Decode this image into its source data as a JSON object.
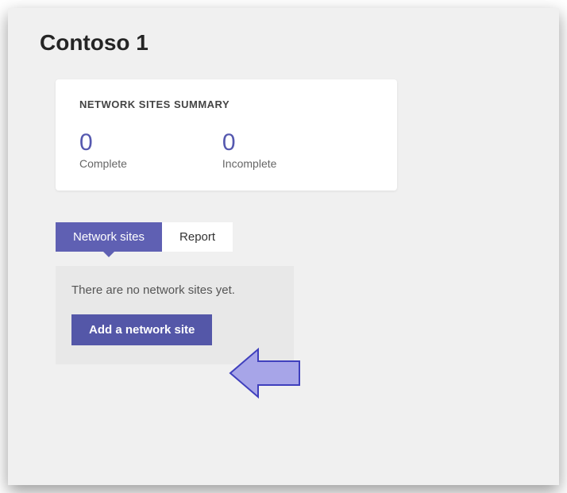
{
  "page_title": "Contoso 1",
  "summary": {
    "header": "NETWORK SITES SUMMARY",
    "stats": [
      {
        "value": "0",
        "label": "Complete"
      },
      {
        "value": "0",
        "label": "Incomplete"
      }
    ]
  },
  "tabs": [
    {
      "label": "Network sites",
      "active": true
    },
    {
      "label": "Report",
      "active": false
    }
  ],
  "panel": {
    "empty_message": "There are no network sites yet.",
    "add_button": "Add a network site"
  },
  "colors": {
    "accent": "#5558af",
    "button": "#5457a8",
    "tab_active": "#5f60b3",
    "arrow_fill": "#a7a5e8",
    "arrow_stroke": "#3f3fbd"
  }
}
